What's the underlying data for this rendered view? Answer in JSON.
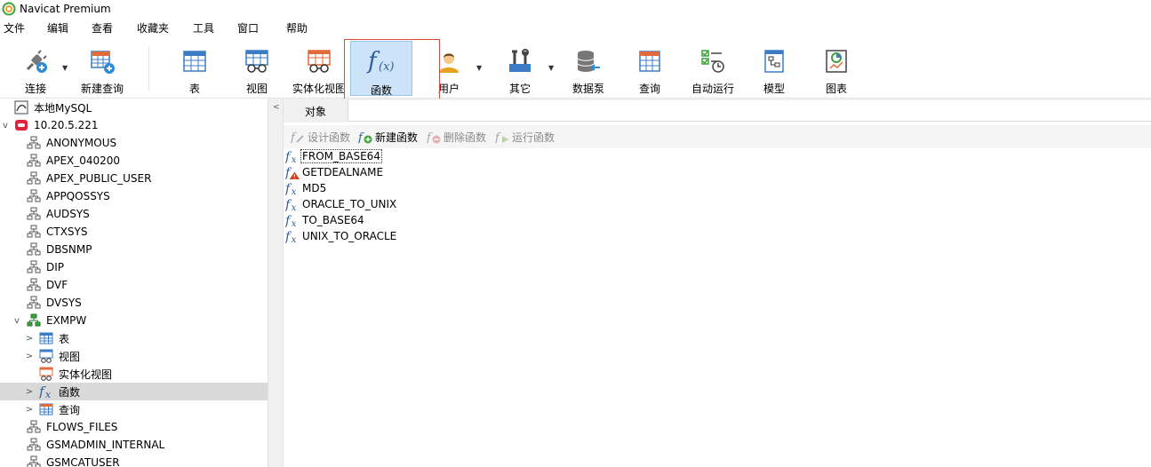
{
  "window": {
    "title": "Navicat Premium"
  },
  "menu": [
    "文件",
    "编辑",
    "查看",
    "收藏夹",
    "工具",
    "窗口",
    "帮助"
  ],
  "toolbar": {
    "connect": "连接",
    "new_query": "新建查询",
    "table": "表",
    "view": "视图",
    "mat_view": "实体化视图",
    "function": "函数",
    "user": "用户",
    "other": "其它",
    "datasource": "数据泵",
    "query": "查询",
    "auto_run": "自动运行",
    "model": "模型",
    "chart": "图表"
  },
  "tree": {
    "local": "本地MySQL",
    "server": "10.20.5.221",
    "schemas": [
      "ANONYMOUS",
      "APEX_040200",
      "APEX_PUBLIC_USER",
      "APPQOSSYS",
      "AUDSYS",
      "CTXSYS",
      "DBSNMP",
      "DIP",
      "DVF",
      "DVSYS"
    ],
    "expanded_schema": "EXMPW",
    "children": {
      "table": "表",
      "view": "视图",
      "mat_view": "实体化视图",
      "function": "函数",
      "query": "查询"
    },
    "more_schemas": [
      "FLOWS_FILES",
      "GSMADMIN_INTERNAL",
      "GSMCATUSER"
    ]
  },
  "tab": {
    "objects": "对象"
  },
  "obj_toolbar": {
    "design": "设计函数",
    "new": "新建函数",
    "delete": "删除函数",
    "run": "运行函数"
  },
  "functions": [
    "FROM_BASE64",
    "GETDEALNAME",
    "MD5",
    "ORACLE_TO_UNIX",
    "TO_BASE64",
    "UNIX_TO_ORACLE"
  ],
  "colors": {
    "selection_bg": "#cde3f7",
    "tree_selected": "#d9d9d9",
    "highlight_box": "#e0463a",
    "server_red": "#e0243a"
  }
}
